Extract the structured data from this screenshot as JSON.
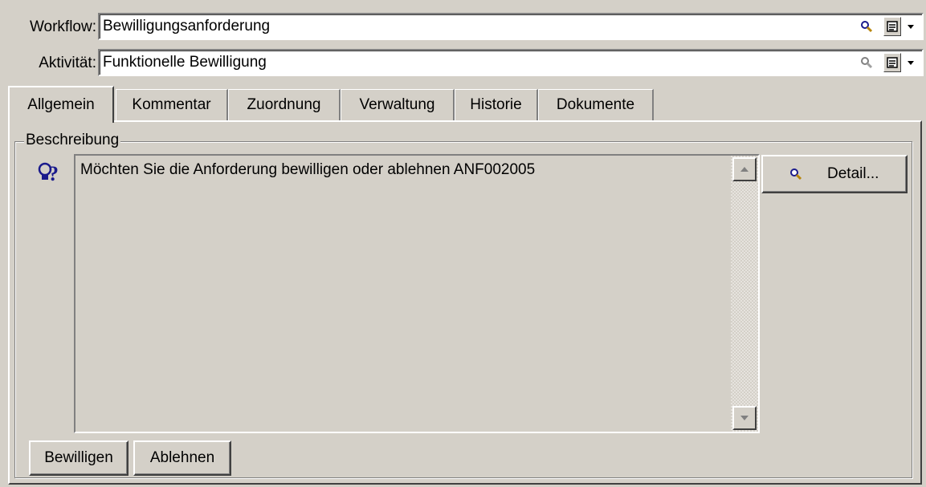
{
  "workflow": {
    "label": "Workflow:",
    "value": "Bewilligungsanforderung"
  },
  "activity": {
    "label": "Aktivität:",
    "value": "Funktionelle Bewilligung"
  },
  "field_buttons": {
    "search_icon": "magnifier-icon",
    "form_icon": "form-icon",
    "dropdown_icon": "dropdown-arrow-icon"
  },
  "tabs": [
    {
      "label": "Allgemein",
      "active": true
    },
    {
      "label": "Kommentar",
      "active": false
    },
    {
      "label": "Zuordnung",
      "active": false
    },
    {
      "label": "Verwaltung",
      "active": false
    },
    {
      "label": "Historie",
      "active": false
    },
    {
      "label": "Dokumente",
      "active": false
    }
  ],
  "description": {
    "group_label": "Beschreibung",
    "icon": "question-bulb-icon",
    "text": "Möchten Sie die Anforderung bewilligen oder ablehnen ANF002005"
  },
  "buttons": {
    "detail": "Detail...",
    "approve": "Bewilligen",
    "reject": "Ablehnen"
  },
  "colors": {
    "window_bg": "#d4d0c8",
    "field_bg": "#ffffff",
    "icon_blue": "#1a1a8c",
    "magnifier_handle": "#b8860b"
  }
}
